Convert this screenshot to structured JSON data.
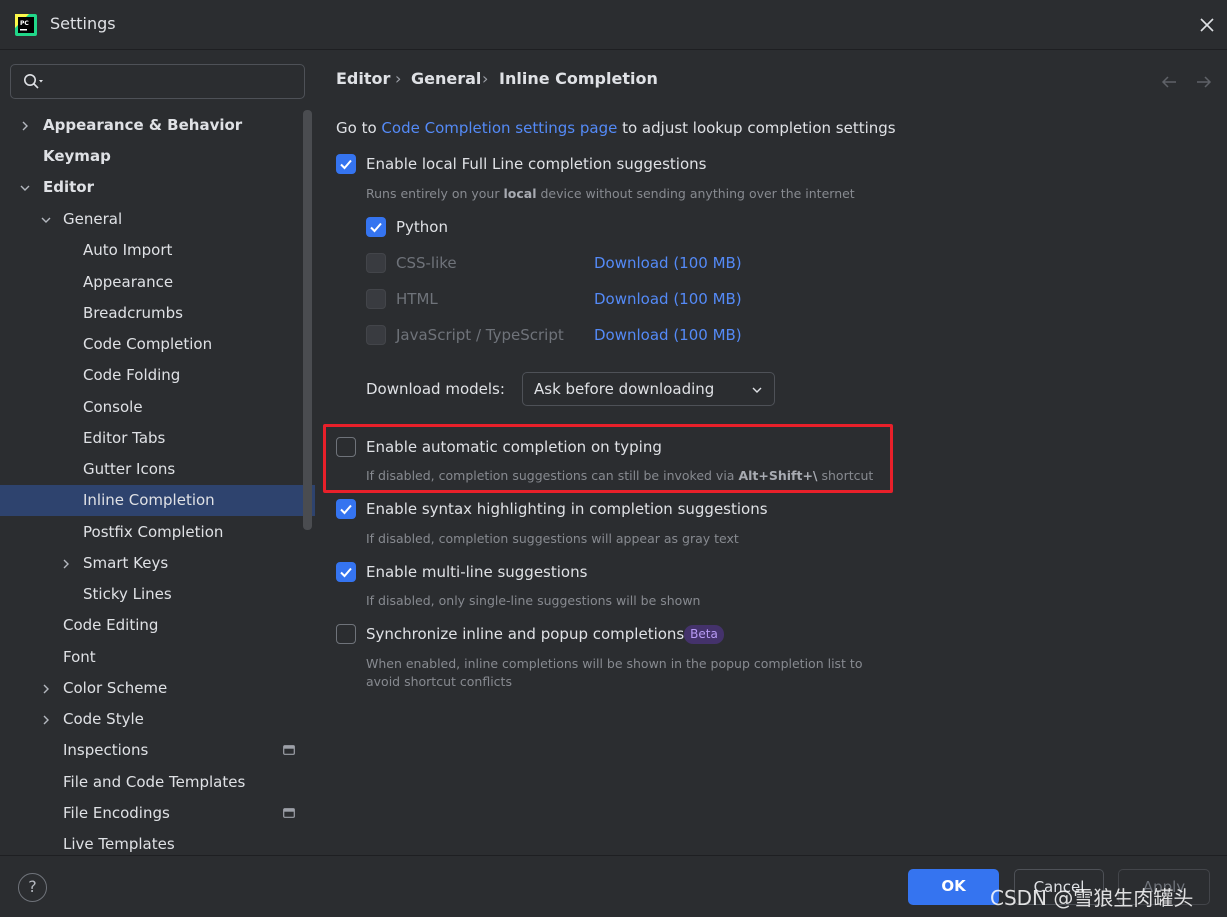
{
  "window": {
    "title": "Settings"
  },
  "search": {
    "placeholder": "",
    "value": ""
  },
  "sidebar": {
    "items": [
      {
        "label": "Appearance & Behavior"
      },
      {
        "label": "Keymap"
      },
      {
        "label": "Editor"
      },
      {
        "label": "General"
      },
      {
        "label": "Auto Import"
      },
      {
        "label": "Appearance"
      },
      {
        "label": "Breadcrumbs"
      },
      {
        "label": "Code Completion"
      },
      {
        "label": "Code Folding"
      },
      {
        "label": "Console"
      },
      {
        "label": "Editor Tabs"
      },
      {
        "label": "Gutter Icons"
      },
      {
        "label": "Inline Completion"
      },
      {
        "label": "Postfix Completion"
      },
      {
        "label": "Smart Keys"
      },
      {
        "label": "Sticky Lines"
      },
      {
        "label": "Code Editing"
      },
      {
        "label": "Font"
      },
      {
        "label": "Color Scheme"
      },
      {
        "label": "Code Style"
      },
      {
        "label": "Inspections"
      },
      {
        "label": "File and Code Templates"
      },
      {
        "label": "File Encodings"
      },
      {
        "label": "Live Templates"
      }
    ]
  },
  "breadcrumb": {
    "level1": "Editor",
    "level2": "General",
    "level3": "Inline Completion",
    "separator": "›"
  },
  "content": {
    "goto_prefix": "Go to",
    "goto_link": "Code Completion settings page",
    "goto_suffix": "to adjust lookup completion settings",
    "full_line": {
      "label": "Enable local Full Line completion suggestions",
      "hint_pre": "Runs entirely on your",
      "hint_bold": "local",
      "hint_post": "device without sending anything over the internet"
    },
    "languages": [
      {
        "label": "Python",
        "download": ""
      },
      {
        "label": "CSS-like",
        "download": "Download (100 MB)"
      },
      {
        "label": "HTML",
        "download": "Download (100 MB)"
      },
      {
        "label": "JavaScript / TypeScript",
        "download": "Download (100 MB)"
      }
    ],
    "download_models": {
      "label": "Download models:",
      "value": "Ask before downloading"
    },
    "auto_completion": {
      "label": "Enable automatic completion on typing",
      "hint_pre": "If disabled, completion suggestions can still be invoked via",
      "hint_bold": "Alt+Shift+\\",
      "hint_post": "shortcut"
    },
    "syntax_highlight": {
      "label": "Enable syntax highlighting in completion suggestions",
      "hint": "If disabled, completion suggestions will appear as gray text"
    },
    "multi_line": {
      "label": "Enable multi-line suggestions",
      "hint": "If disabled, only single-line suggestions will be shown"
    },
    "sync_popup": {
      "label": "Synchronize inline and popup completions",
      "badge": "Beta",
      "hint_line1": "When enabled, inline completions will be shown in the popup completion list to",
      "hint_line2": "avoid shortcut conflicts"
    }
  },
  "footer": {
    "help": "?",
    "ok": "OK",
    "cancel": "Cancel",
    "apply": "Apply"
  },
  "watermark": "CSDN @雪狼生肉罐头",
  "colors": {
    "accent": "#3574f0",
    "link": "#548af7",
    "highlight_box": "#e8202a",
    "selected_row": "#2e436e"
  }
}
